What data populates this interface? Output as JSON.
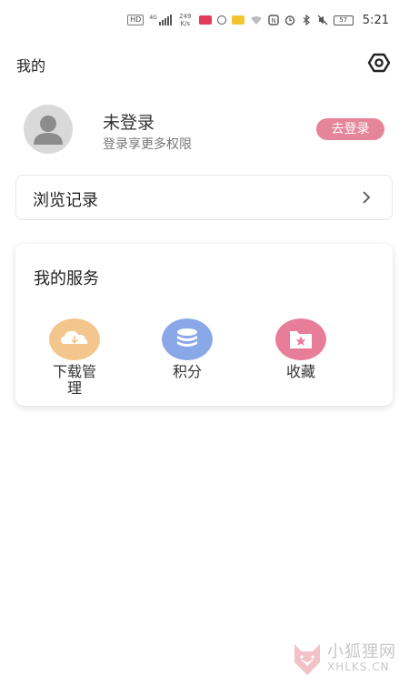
{
  "status_bar": {
    "hd": "HD",
    "network": "4G",
    "speed_value": "249",
    "speed_unit": "K/s",
    "battery": "57",
    "time": "5:21"
  },
  "header": {
    "title": "我的"
  },
  "profile": {
    "name": "未登录",
    "subtitle": "登录享更多权限",
    "login_label": "去登录"
  },
  "history": {
    "label": "浏览记录"
  },
  "services": {
    "title": "我的服务",
    "items": [
      {
        "label": "下载管理",
        "icon": "cloud-download-icon",
        "color": "#f2c68c"
      },
      {
        "label": "积分",
        "icon": "coin-stack-icon",
        "color": "#8aa8e8"
      },
      {
        "label": "收藏",
        "icon": "folder-star-icon",
        "color": "#e77d98"
      }
    ]
  },
  "watermark": {
    "cn": "小狐狸网",
    "en": "XHLKS.CN"
  },
  "colors": {
    "accent": "#e5859a",
    "download": "#f2c68c",
    "points": "#8aa8e8",
    "favorites": "#e77d98"
  }
}
